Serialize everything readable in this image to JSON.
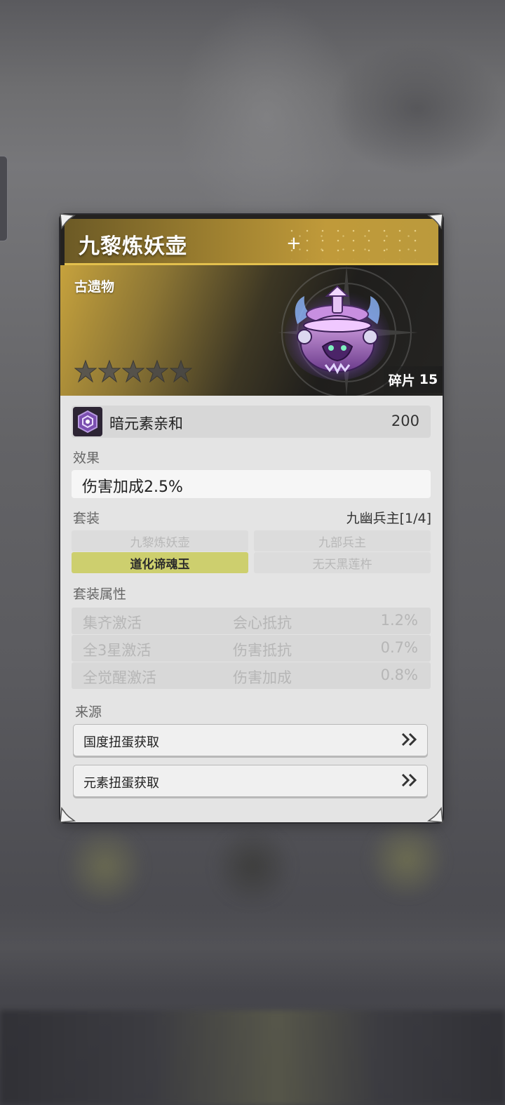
{
  "item": {
    "title": "九黎炼妖壶",
    "category": "古遗物",
    "stars_filled": 0,
    "stars_total": 5,
    "fragments_label": "碎片",
    "fragments_count": "15"
  },
  "affinity": {
    "icon": "dark-element-icon",
    "label": "暗元素亲和",
    "value": "200"
  },
  "effect": {
    "label": "效果",
    "text": "伤害加成2.5%"
  },
  "set": {
    "label": "套装",
    "name": "九幽兵主[1/4]",
    "items": [
      {
        "label": "九黎炼妖壶",
        "active": false
      },
      {
        "label": "九部兵主",
        "active": false
      },
      {
        "label": "道化谛魂玉",
        "active": true
      },
      {
        "label": "无天黑莲杵",
        "active": false
      }
    ]
  },
  "set_attributes": {
    "label": "套装属性",
    "rows": [
      {
        "condition": "集齐激活",
        "attribute": "会心抵抗",
        "value": "1.2%"
      },
      {
        "condition": "全3星激活",
        "attribute": "伤害抵抗",
        "value": "0.7%"
      },
      {
        "condition": "全觉醒激活",
        "attribute": "伤害加成",
        "value": "0.8%"
      }
    ]
  },
  "source": {
    "label": "来源",
    "buttons": [
      {
        "label": "国度扭蛋获取",
        "icon": "double-chevron-right-icon"
      },
      {
        "label": "元素扭蛋获取",
        "icon": "double-chevron-right-icon"
      }
    ]
  },
  "colors": {
    "gold": "#c09a3a",
    "gold_border": "#e3c04d",
    "active_set": "#cdcf6e",
    "card_bg": "#e4e4e4",
    "dark_element": "#7b4fb0"
  }
}
